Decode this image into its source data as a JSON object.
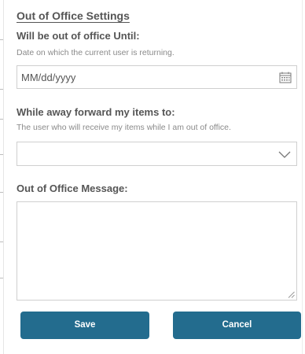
{
  "form": {
    "title": "Out of Office Settings",
    "until": {
      "label": "Will be out of office Until:",
      "hint": "Date on which the current user is returning.",
      "placeholder": "MM/dd/yyyy",
      "icon": "calendar-icon"
    },
    "forward": {
      "label": "While away forward my items to:",
      "hint": "The user who will receive my items while I am out of office.",
      "value": "",
      "icon": "chevron-down-icon"
    },
    "message": {
      "label": "Out of Office Message:",
      "value": ""
    }
  },
  "buttons": {
    "save_label": "Save",
    "cancel_label": "Cancel"
  },
  "colors": {
    "button_bg": "#236c8e",
    "border": "#cfcfcf",
    "label_text": "#555555",
    "hint_text": "#8a8a8a"
  }
}
